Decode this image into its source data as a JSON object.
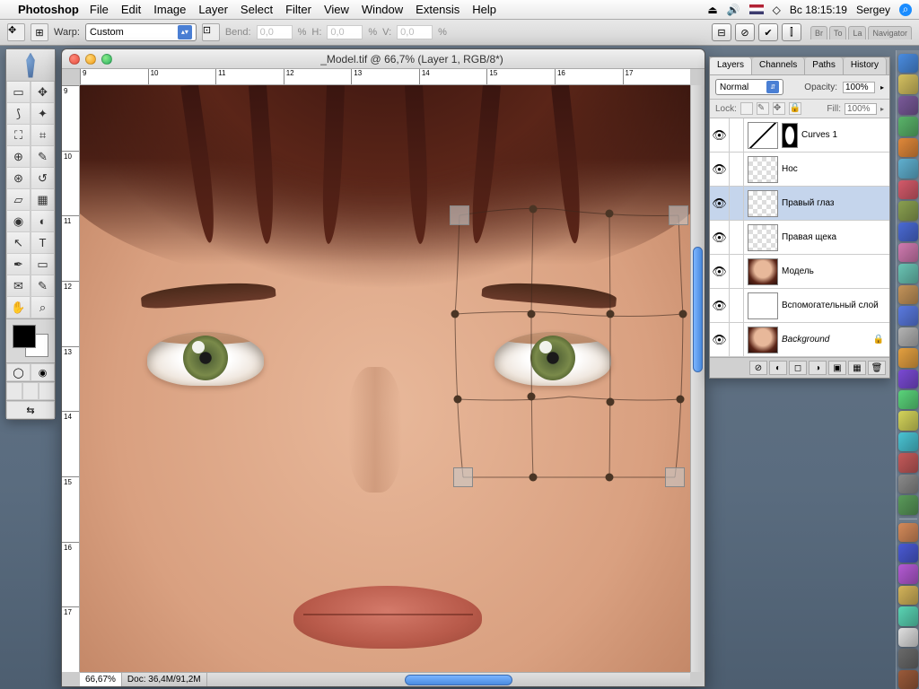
{
  "menubar": {
    "app": "Photoshop",
    "items": [
      "File",
      "Edit",
      "Image",
      "Layer",
      "Select",
      "Filter",
      "View",
      "Window",
      "Extensis",
      "Help"
    ],
    "clock": "Bc 18:15:19",
    "user": "Sergey"
  },
  "options": {
    "warp_label": "Warp:",
    "warp_value": "Custom",
    "bend_label": "Bend:",
    "bend_value": "0,0",
    "h_label": "H:",
    "h_value": "0,0",
    "v_label": "V:",
    "v_value": "0,0",
    "pct": "%",
    "nav_tabs": [
      "Br",
      "To",
      "La",
      "Navigator"
    ]
  },
  "document": {
    "title": "_Model.tif @ 66,7% (Layer 1, RGB/8*)",
    "zoom": "66,67%",
    "docinfo": "Doc: 36,4M/91,2M",
    "ruler_h": [
      "9",
      "10",
      "11",
      "12",
      "13",
      "14",
      "15",
      "16",
      "17"
    ],
    "ruler_v": [
      "9",
      "10",
      "11",
      "12",
      "13",
      "14",
      "15",
      "16",
      "17"
    ]
  },
  "layers_panel": {
    "tabs": [
      "Layers",
      "Channels",
      "Paths",
      "History"
    ],
    "blend_mode": "Normal",
    "opacity_label": "Opacity:",
    "opacity_value": "100%",
    "lock_label": "Lock:",
    "fill_label": "Fill:",
    "fill_value": "100%",
    "layers": [
      {
        "name": "Curves 1",
        "type": "curves"
      },
      {
        "name": "Нос",
        "type": "checker"
      },
      {
        "name": "Правый глаз",
        "type": "checker",
        "selected": true
      },
      {
        "name": "Правая щека",
        "type": "checker"
      },
      {
        "name": "Модель",
        "type": "face"
      },
      {
        "name": "Вспомогательный слой",
        "type": "white"
      },
      {
        "name": "Background",
        "type": "face",
        "locked": true,
        "italic": true
      }
    ]
  },
  "dock_colors": [
    "#4a8ce0",
    "#d4c060",
    "#7a5a9a",
    "#5ab46a",
    "#e0883a",
    "#60b0d0",
    "#d45a6a",
    "#8aa050",
    "#4a6ad4",
    "#d07ab0",
    "#6ac4b4",
    "#c4945a",
    "#5a7ae0",
    "#b4b4b4",
    "#e4a040",
    "#7a4ad4",
    "#5ad47a",
    "#d4d45a",
    "#4ac4d4",
    "#c45a5a",
    "#8a8a8a",
    "#5a9a5a",
    "#d48a5a",
    "#4a5ad4",
    "#b45ad4",
    "#d4b45a",
    "#5ad4b4",
    "#e0e0e0",
    "#6a6a6a",
    "#9a5a3a"
  ]
}
